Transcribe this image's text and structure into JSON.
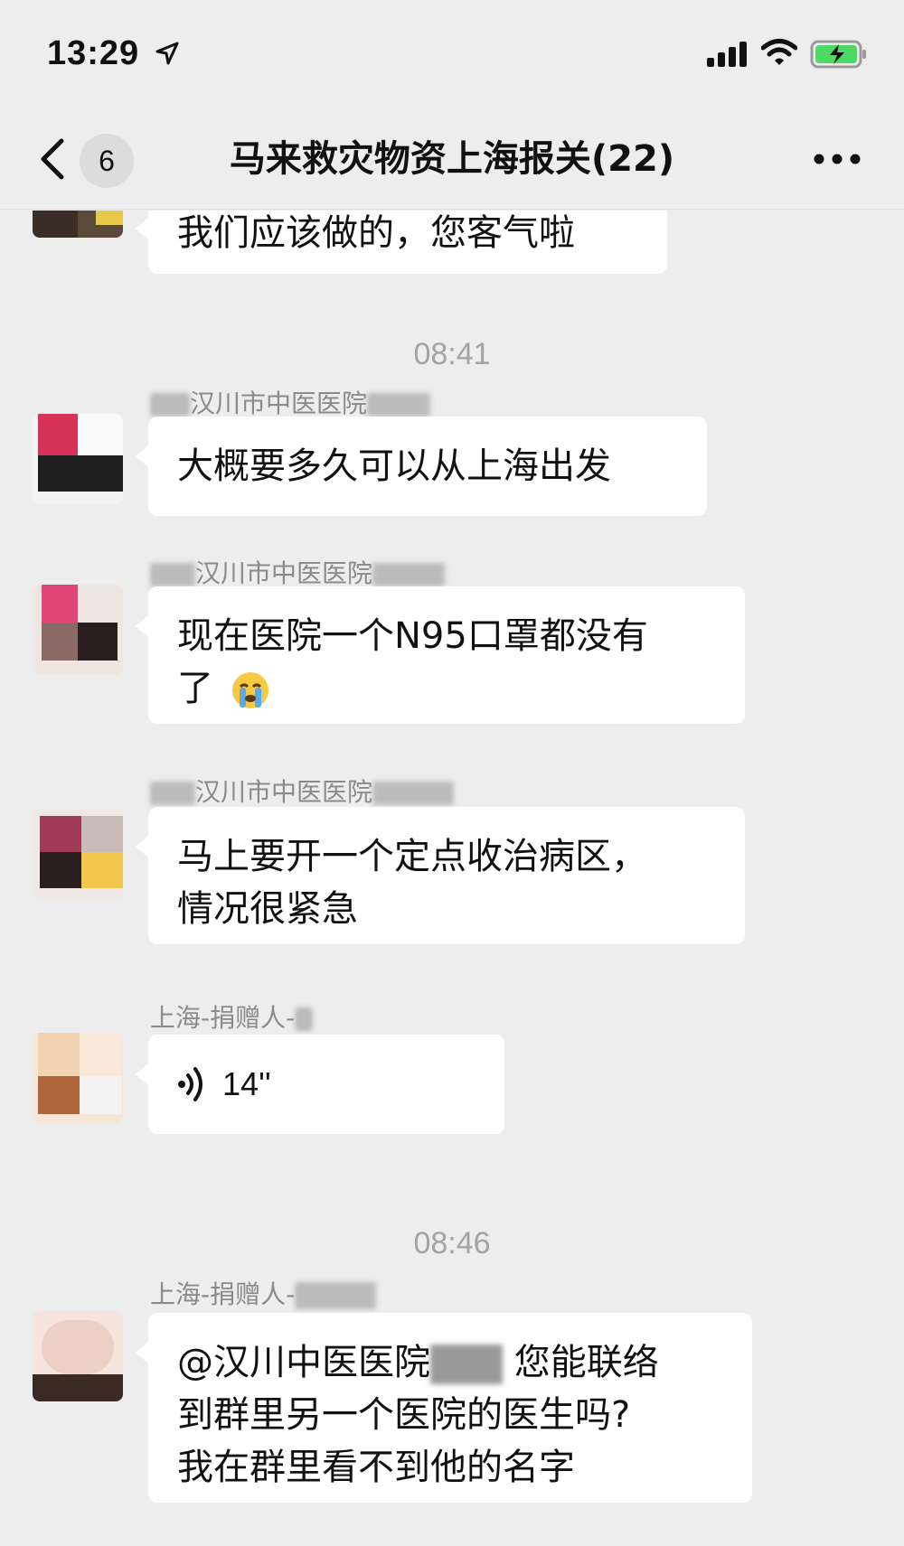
{
  "status_bar": {
    "time": "13:29",
    "icons": [
      "location-arrow-icon",
      "cellular-signal-icon",
      "wifi-icon",
      "battery-charging-icon"
    ]
  },
  "nav": {
    "unread_count": "6",
    "title": "马来救灾物资上海报关(22)",
    "icons": [
      "back-chevron-icon",
      "more-dots-icon"
    ]
  },
  "colors": {
    "background": "#ededed",
    "bubble": "#ffffff",
    "timestamp_text": "#a3a3a3",
    "sender_text": "#8a8a8a"
  },
  "messages": [
    {
      "text": "我们应该做的，您客气啦"
    },
    {
      "timestamp": "08:41"
    },
    {
      "sender": "汉川市中医医院",
      "text": "大概要多久可以从上海出发"
    },
    {
      "sender": "汉川市中医医院",
      "text_line1": "现在医院一个N95口罩都没有",
      "text_line2": "了"
    },
    {
      "sender": "汉川市中医医院",
      "text_line1": "马上要开一个定点收治病区，",
      "text_line2": "情况很紧急"
    },
    {
      "sender": "上海-捐赠人-",
      "voice_duration": "14''"
    },
    {
      "timestamp": "08:46"
    },
    {
      "sender": "上海-捐赠人-",
      "mention": "@汉川中医医院",
      "text_line1_rest": "您能联络",
      "text_line2": "到群里另一个医院的医生吗?",
      "text_line3": "我在群里看不到他的名字"
    }
  ]
}
